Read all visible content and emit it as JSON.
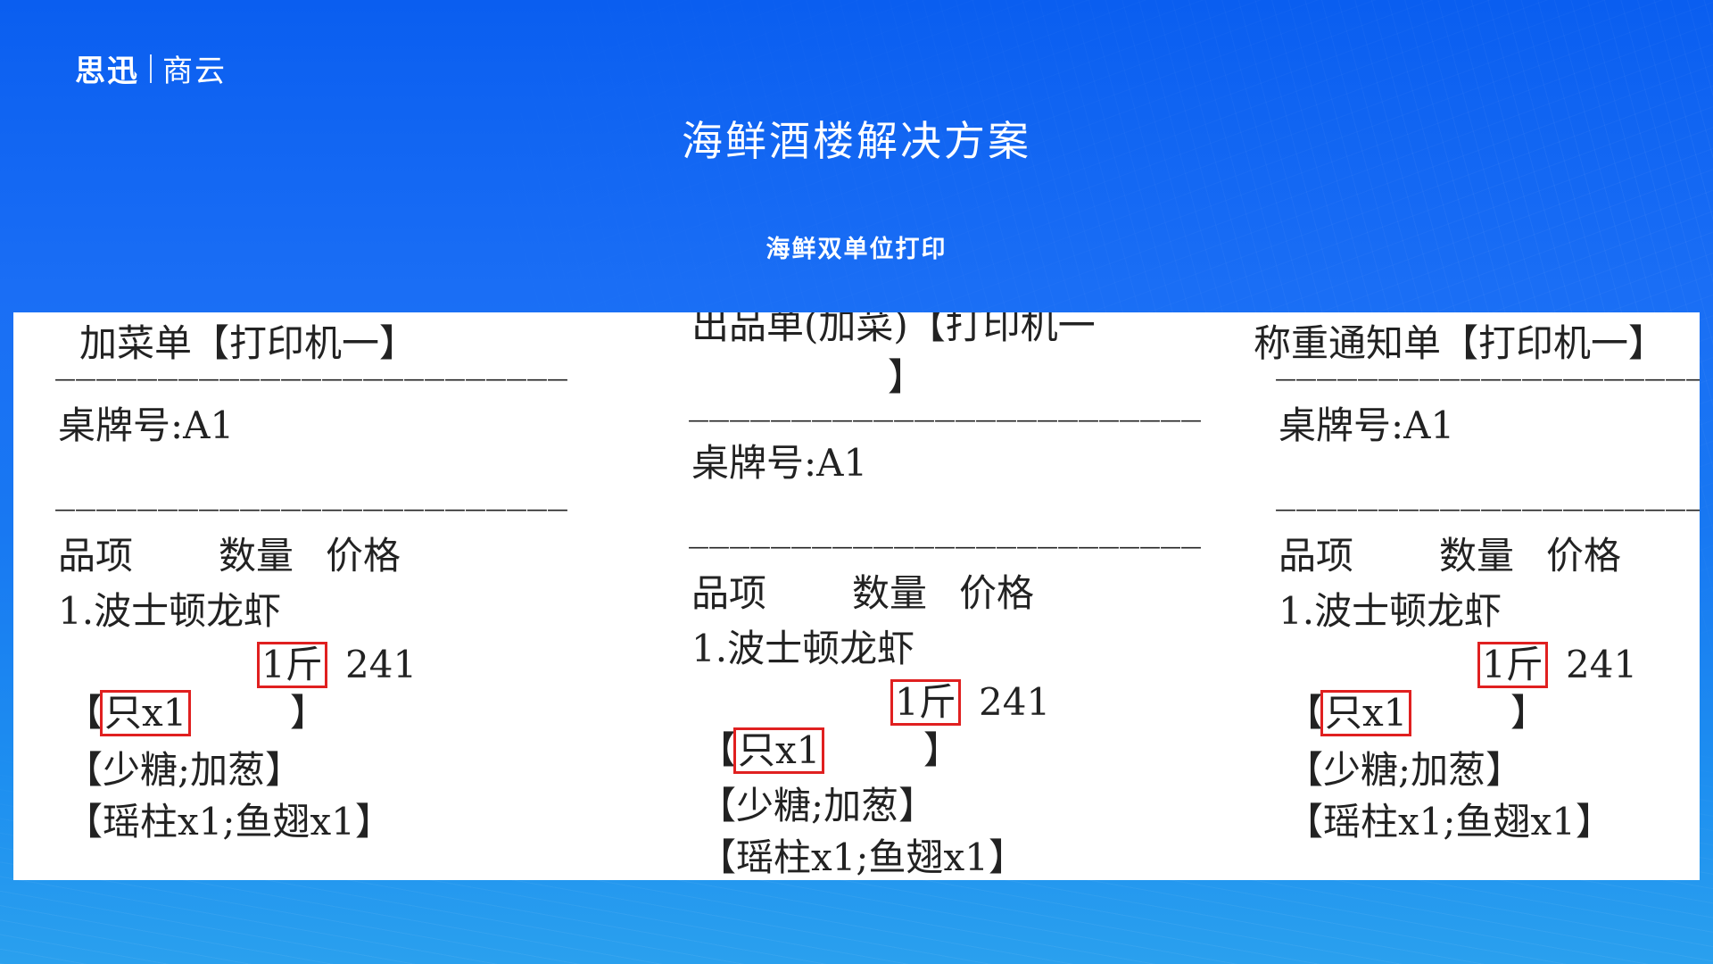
{
  "brand": {
    "name_a": "思迅",
    "name_b": "商云"
  },
  "title": "海鲜酒楼解决方案",
  "subtitle": "海鲜双单位打印",
  "colors": {
    "background": "#1a6ef5",
    "highlight": "#e02020"
  },
  "tickets": [
    {
      "header": "加菜单【打印机一】",
      "divider": "—————————————————————————",
      "table_no": "桌牌号:A1",
      "col_item": "品项",
      "col_qty": "数量",
      "col_price": "价格",
      "item_name": "1.波士顿龙虾",
      "qty": "1斤",
      "price": "241",
      "bracket_open": "【",
      "unit": "只x1",
      "bracket_close": "】",
      "note1": "【少糖;加葱】",
      "note2": "【瑶柱x1;鱼翅x1】"
    },
    {
      "header": "出品单(加菜)【打印机一",
      "header_cont": "】",
      "divider": "—————————————————————————",
      "table_no": "桌牌号:A1",
      "col_item": "品项",
      "col_qty": "数量",
      "col_price": "价格",
      "item_name": "1.波士顿龙虾",
      "qty": "1斤",
      "price": "241",
      "bracket_open": "【",
      "unit": "只x1",
      "bracket_close": "】",
      "note1": "【少糖;加葱】",
      "note2": "【瑶柱x1;鱼翅x1】"
    },
    {
      "header": "称重通知单【打印机一】",
      "divider": "—————————————————————————",
      "table_no": "桌牌号:A1",
      "col_item": "品项",
      "col_qty": "数量",
      "col_price": "价格",
      "item_name": "1.波士顿龙虾",
      "qty": "1斤",
      "price": "241",
      "bracket_open": "【",
      "unit": "只x1",
      "bracket_close": "】",
      "note1": "【少糖;加葱】",
      "note2": "【瑶柱x1;鱼翅x1】"
    }
  ]
}
